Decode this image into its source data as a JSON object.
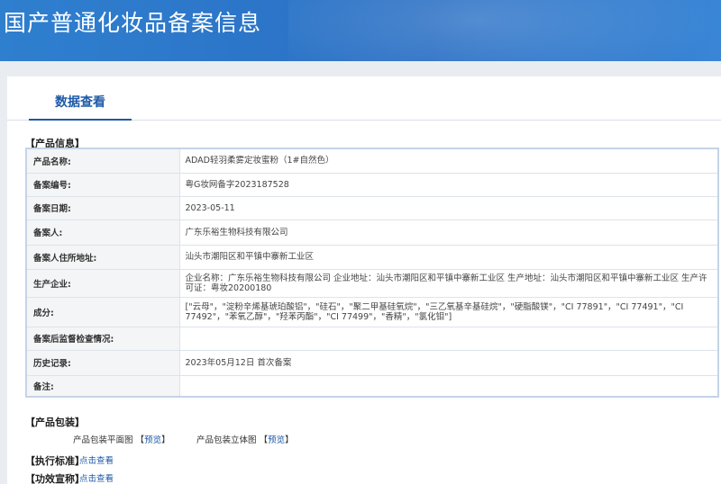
{
  "header": {
    "title": "国产普通化妆品备案信息"
  },
  "tabs": {
    "data_view": "数据查看"
  },
  "product_section": {
    "title": "【产品信息】",
    "rows": [
      {
        "label": "产品名称:",
        "value": "ADAD轻羽柔雾定妆蜜粉（1#自然色）"
      },
      {
        "label": "备案编号:",
        "value": "粤G妆网备字2023187528"
      },
      {
        "label": "备案日期:",
        "value": "2023-05-11"
      },
      {
        "label": "备案人:",
        "value": "广东乐裕生物科技有限公司"
      },
      {
        "label": "备案人住所地址:",
        "value": "汕头市潮阳区和平镇中寨新工业区"
      },
      {
        "label": "生产企业:",
        "value": "企业名称：广东乐裕生物科技有限公司 企业地址：汕头市潮阳区和平镇中寨新工业区 生产地址：汕头市潮阳区和平镇中寨新工业区 生产许可证：粤妆20200180"
      },
      {
        "label": "成分:",
        "value": "[\"云母\"，\"淀粉辛烯基琥珀酸铝\"，\"硅石\"，\"聚二甲基硅氧烷\"，\"三乙氧基辛基硅烷\"，\"硬脂酸镁\"，\"CI 77891\"，\"CI 77491\"，\"CI 77492\"，\"苯氧乙醇\"，\"羟苯丙酯\"，\"CI 77499\"，\"香精\"，\"氯化钼\"]"
      },
      {
        "label": "备案后监督检查情况:",
        "value": ""
      },
      {
        "label": "历史记录:",
        "value": "2023年05月12日 首次备案"
      },
      {
        "label": "备注:",
        "value": ""
      }
    ]
  },
  "packaging_section": {
    "title": "【产品包装】",
    "flat_label": "产品包装平面图",
    "solid_label": "产品包装立体图",
    "bracket_open": "【",
    "bracket_close": "】",
    "preview_label": "预览"
  },
  "standard_section": {
    "title": "【执行标准】",
    "link": "点击查看"
  },
  "efficacy_section": {
    "title": "【功效宣称】",
    "link": "点击查看"
  }
}
